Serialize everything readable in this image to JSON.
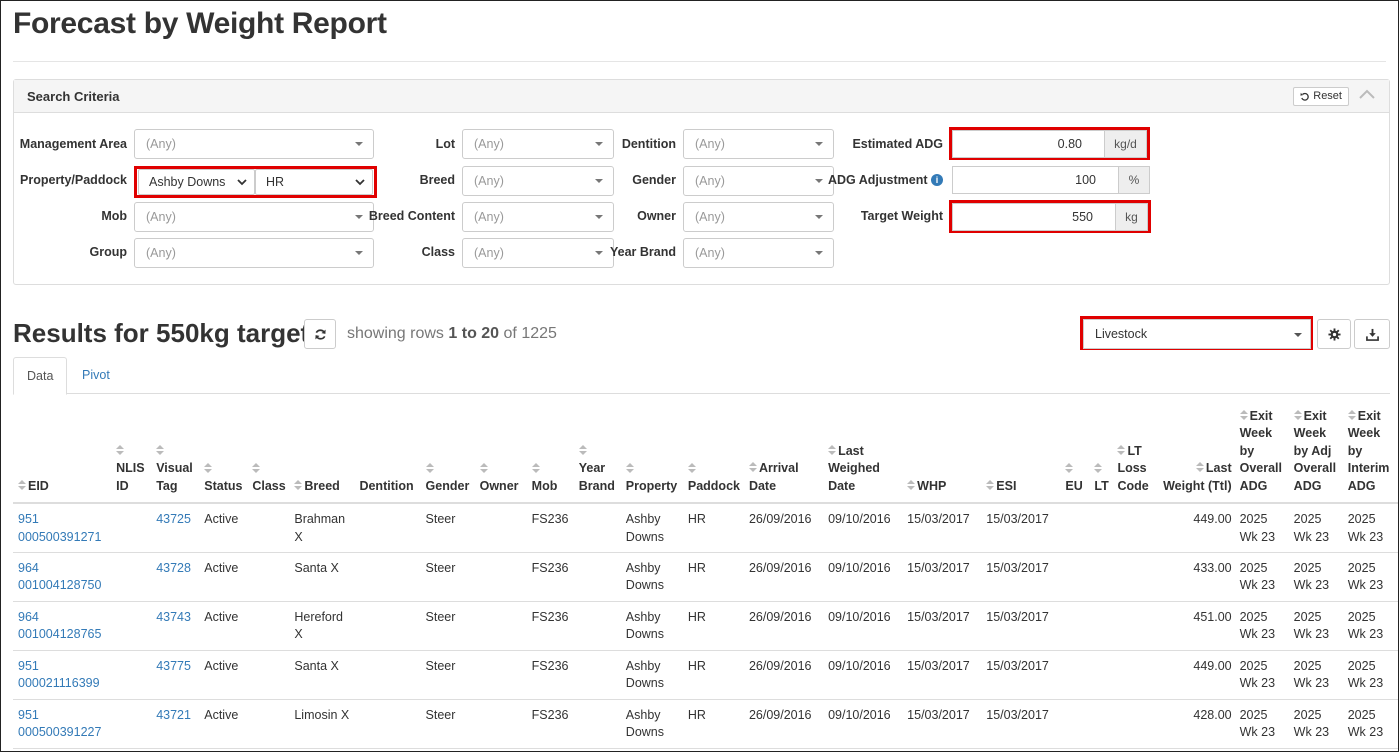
{
  "page": {
    "title": "Forecast by Weight Report"
  },
  "search": {
    "title": "Search Criteria",
    "reset_label": "Reset",
    "fields": {
      "management_area": {
        "label": "Management Area",
        "value": "(Any)"
      },
      "property_paddock": {
        "label": "Property/Paddock",
        "property": "Ashby Downs",
        "paddock": "HR"
      },
      "mob": {
        "label": "Mob",
        "value": "(Any)"
      },
      "group": {
        "label": "Group",
        "value": "(Any)"
      },
      "lot": {
        "label": "Lot",
        "value": "(Any)"
      },
      "breed": {
        "label": "Breed",
        "value": "(Any)"
      },
      "breed_content": {
        "label": "Breed Content",
        "value": "(Any)"
      },
      "class": {
        "label": "Class",
        "value": "(Any)"
      },
      "dentition": {
        "label": "Dentition",
        "value": "(Any)"
      },
      "gender": {
        "label": "Gender",
        "value": "(Any)"
      },
      "owner": {
        "label": "Owner",
        "value": "(Any)"
      },
      "year_brand": {
        "label": "Year Brand",
        "value": "(Any)"
      },
      "estimated_adg": {
        "label": "Estimated ADG",
        "value": "0.80",
        "unit": "kg/d"
      },
      "adg_adjustment": {
        "label": "ADG Adjustment",
        "value": "100",
        "unit": "%"
      },
      "target_weight": {
        "label": "Target Weight",
        "value": "550",
        "unit": "kg"
      }
    }
  },
  "results": {
    "title": "Results for 550kg target",
    "showing_prefix": "showing rows",
    "showing_range": "1 to 20",
    "showing_of": "of 1225",
    "view_select": "Livestock",
    "tabs": [
      "Data",
      "Pivot"
    ],
    "columns": [
      "EID",
      "NLIS ID",
      "Visual Tag",
      "Status",
      "Class",
      "Breed",
      "Dentition",
      "Gender",
      "Owner",
      "Mob",
      "Year Brand",
      "Property",
      "Paddock",
      "Arrival Date",
      "Last Weighed Date",
      "WHP",
      "ESI",
      "EU",
      "LT",
      "LT Loss Code",
      "Last Weight (Ttl)",
      "Exit Week by Overall ADG",
      "Exit Week by Adj Overall ADG",
      "Exit Week by Interim ADG"
    ],
    "rows": [
      {
        "eid": "951 000500391271",
        "nlis": "",
        "visual_tag": "43725",
        "status": "Active",
        "class": "",
        "breed": "Brahman X",
        "dentition": "",
        "gender": "Steer",
        "owner": "",
        "mob": "FS236",
        "year_brand": "",
        "property": "Ashby Downs",
        "paddock": "HR",
        "arrival": "26/09/2016",
        "last_weighed": "09/10/2016",
        "whp": "15/03/2017",
        "esi": "15/03/2017",
        "eu": "",
        "lt": "",
        "lt_loss": "",
        "last_weight": "449.00",
        "exit_overall": "2025 Wk 23",
        "exit_adj": "2025 Wk 23",
        "exit_interim": "2025 Wk 23"
      },
      {
        "eid": "964 001004128750",
        "nlis": "",
        "visual_tag": "43728",
        "status": "Active",
        "class": "",
        "breed": "Santa X",
        "dentition": "",
        "gender": "Steer",
        "owner": "",
        "mob": "FS236",
        "year_brand": "",
        "property": "Ashby Downs",
        "paddock": "HR",
        "arrival": "26/09/2016",
        "last_weighed": "09/10/2016",
        "whp": "15/03/2017",
        "esi": "15/03/2017",
        "eu": "",
        "lt": "",
        "lt_loss": "",
        "last_weight": "433.00",
        "exit_overall": "2025 Wk 23",
        "exit_adj": "2025 Wk 23",
        "exit_interim": "2025 Wk 23"
      },
      {
        "eid": "964 001004128765",
        "nlis": "",
        "visual_tag": "43743",
        "status": "Active",
        "class": "",
        "breed": "Hereford X",
        "dentition": "",
        "gender": "Steer",
        "owner": "",
        "mob": "FS236",
        "year_brand": "",
        "property": "Ashby Downs",
        "paddock": "HR",
        "arrival": "26/09/2016",
        "last_weighed": "09/10/2016",
        "whp": "15/03/2017",
        "esi": "15/03/2017",
        "eu": "",
        "lt": "",
        "lt_loss": "",
        "last_weight": "451.00",
        "exit_overall": "2025 Wk 23",
        "exit_adj": "2025 Wk 23",
        "exit_interim": "2025 Wk 23"
      },
      {
        "eid": "951 000021116399",
        "nlis": "",
        "visual_tag": "43775",
        "status": "Active",
        "class": "",
        "breed": "Santa X",
        "dentition": "",
        "gender": "Steer",
        "owner": "",
        "mob": "FS236",
        "year_brand": "",
        "property": "Ashby Downs",
        "paddock": "HR",
        "arrival": "26/09/2016",
        "last_weighed": "09/10/2016",
        "whp": "15/03/2017",
        "esi": "15/03/2017",
        "eu": "",
        "lt": "",
        "lt_loss": "",
        "last_weight": "449.00",
        "exit_overall": "2025 Wk 23",
        "exit_adj": "2025 Wk 23",
        "exit_interim": "2025 Wk 23"
      },
      {
        "eid": "951 000500391227",
        "nlis": "",
        "visual_tag": "43721",
        "status": "Active",
        "class": "",
        "breed": "Limosin X",
        "dentition": "",
        "gender": "Steer",
        "owner": "",
        "mob": "FS236",
        "year_brand": "",
        "property": "Ashby Downs",
        "paddock": "HR",
        "arrival": "26/09/2016",
        "last_weighed": "09/10/2016",
        "whp": "15/03/2017",
        "esi": "15/03/2017",
        "eu": "",
        "lt": "",
        "lt_loss": "",
        "last_weight": "428.00",
        "exit_overall": "2025 Wk 23",
        "exit_adj": "2025 Wk 23",
        "exit_interim": "2025 Wk 23"
      }
    ]
  },
  "colors": {
    "link": "#337ab7",
    "highlight": "#e00000",
    "border": "#dddddd"
  }
}
